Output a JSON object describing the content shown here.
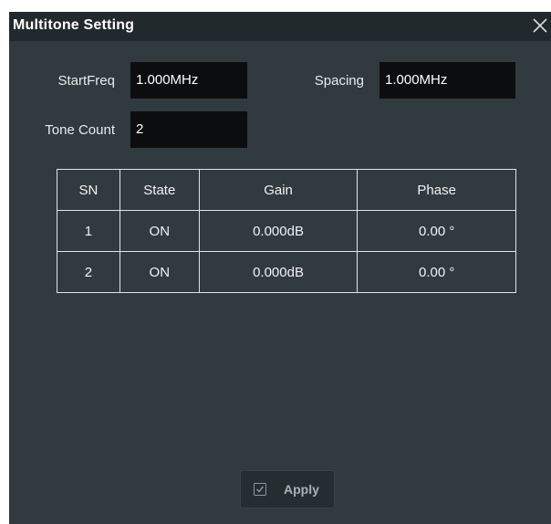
{
  "dialog": {
    "title": "Multitone Setting",
    "close_icon": "close-x-icon"
  },
  "fields": {
    "start_freq": {
      "label": "StartFreq",
      "value": "1.000MHz"
    },
    "spacing": {
      "label": "Spacing",
      "value": "1.000MHz"
    },
    "tone_count": {
      "label": "Tone Count",
      "value": "2"
    }
  },
  "table": {
    "headers": [
      "SN",
      "State",
      "Gain",
      "Phase"
    ],
    "rows": [
      [
        "1",
        "ON",
        "0.000dB",
        "0.00 °"
      ],
      [
        "2",
        "ON",
        "0.000dB",
        "0.00 °"
      ]
    ]
  },
  "apply_button": {
    "label": "Apply",
    "icon": "checkbox-checked-icon"
  },
  "colors": {
    "dialog_bg": "#313a3e",
    "titlebar_bg": "#22292c",
    "field_bg": "#0b0d0e",
    "text": "#ffffff"
  }
}
